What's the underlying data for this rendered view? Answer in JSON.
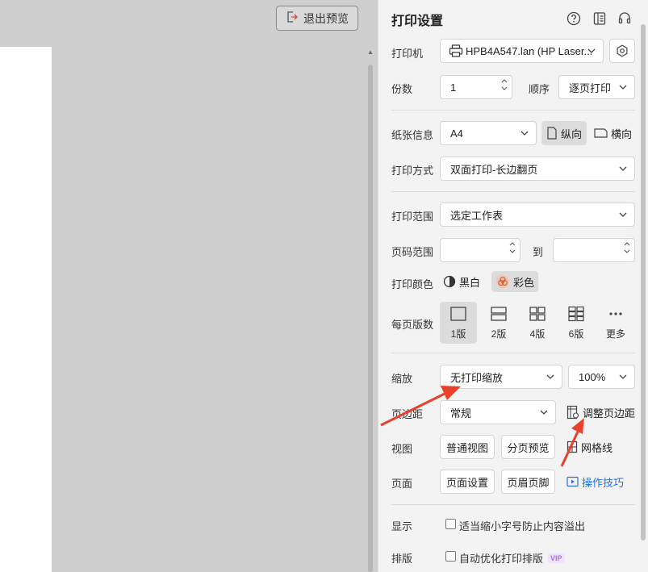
{
  "preview": {
    "exit_label": "退出预览"
  },
  "panel": {
    "title": "打印设置",
    "printer": {
      "label": "打印机",
      "value": "HPB4A547.lan (HP Laser..."
    },
    "copies": {
      "label": "份数",
      "value": "1"
    },
    "order": {
      "label": "顺序",
      "value": "逐页打印"
    },
    "paper": {
      "label": "纸张信息",
      "value": "A4",
      "portrait": "纵向",
      "landscape": "横向"
    },
    "method": {
      "label": "打印方式",
      "value": "双面打印-长边翻页"
    },
    "range": {
      "label": "打印范围",
      "value": "选定工作表"
    },
    "page_range": {
      "label": "页码范围",
      "from": "",
      "to_label": "到",
      "to": ""
    },
    "color": {
      "label": "打印颜色",
      "bw": "黑白",
      "color": "彩色"
    },
    "per_page": {
      "label": "每页版数",
      "options": [
        {
          "label": "1版",
          "icon": "single-page-icon"
        },
        {
          "label": "2版",
          "icon": "two-up-icon"
        },
        {
          "label": "4版",
          "icon": "four-up-icon"
        },
        {
          "label": "6版",
          "icon": "six-up-icon"
        },
        {
          "label": "更多",
          "icon": "more-icon"
        }
      ],
      "selected": "1版"
    },
    "scale": {
      "label": "缩放",
      "value": "无打印缩放",
      "percent": "100%"
    },
    "margin": {
      "label": "页边距",
      "value": "常规",
      "adjust": "调整页边距"
    },
    "view": {
      "label": "视图",
      "normal": "普通视图",
      "page_break": "分页预览",
      "gridlines": "网格线"
    },
    "page": {
      "label": "页面",
      "setup": "页面设置",
      "header_footer": "页眉页脚",
      "tips": "操作技巧"
    },
    "display": {
      "label": "显示",
      "option": "适当缩小字号防止内容溢出",
      "checked": false
    },
    "typeset": {
      "label": "排版",
      "option": "自动优化打印排版",
      "badge": "VIP",
      "checked": false
    }
  },
  "colors": {
    "accent": "#2a6fd6",
    "annotation_arrow": "#e8412c",
    "vip": "#b06cf0"
  }
}
